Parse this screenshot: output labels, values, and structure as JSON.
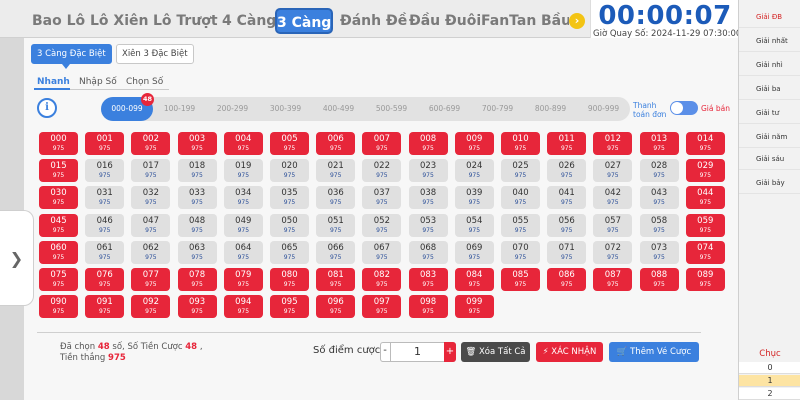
{
  "game_tabs": [
    {
      "label": "Bao Lô"
    },
    {
      "label": "Lô Xiên"
    },
    {
      "label": "Lô Trượt"
    },
    {
      "label": "4 Càng"
    },
    {
      "label": "3 Càng",
      "active": true
    },
    {
      "label": "Đánh Đề"
    },
    {
      "label": "Đầu Đuôi"
    },
    {
      "label": "FanTan"
    },
    {
      "label": "Bầu"
    }
  ],
  "timer": {
    "countdown": "00:00:07",
    "draw_time": "Giờ Quay Số: 2024-11-29 07:30:00"
  },
  "prizes": [
    "Giải ĐB",
    "Giải nhất",
    "Giải nhì",
    "Giải ba",
    "Giải tư",
    "Giải năm",
    "Giải sáu",
    "Giải bảy"
  ],
  "chuc": {
    "title": "Chục",
    "rows": [
      "0",
      "1",
      "2"
    ]
  },
  "sub_tabs": [
    "3 Càng Đặc Biệt",
    "Xiên 3 Đặc Biệt"
  ],
  "modes": [
    "Nhanh",
    "Nhập Số",
    "Chọn Số"
  ],
  "info_icon": "i",
  "ranges": [
    "000-099",
    "100-199",
    "200-299",
    "300-399",
    "400-499",
    "500-599",
    "600-699",
    "700-799",
    "800-899",
    "900-999"
  ],
  "range_badge": "48",
  "quick_label": "Thanh toán đơn",
  "toggle_label": "Giá bán",
  "odds": "975",
  "numbers": [
    "000",
    "001",
    "002",
    "003",
    "004",
    "005",
    "006",
    "007",
    "008",
    "009",
    "010",
    "011",
    "012",
    "013",
    "014",
    "015",
    "016",
    "017",
    "018",
    "019",
    "020",
    "021",
    "022",
    "023",
    "024",
    "025",
    "026",
    "027",
    "028",
    "029",
    "030",
    "031",
    "032",
    "033",
    "034",
    "035",
    "036",
    "037",
    "038",
    "039",
    "040",
    "041",
    "042",
    "043",
    "044",
    "045",
    "046",
    "047",
    "048",
    "049",
    "050",
    "051",
    "052",
    "053",
    "054",
    "055",
    "056",
    "057",
    "058",
    "059",
    "060",
    "061",
    "062",
    "063",
    "064",
    "065",
    "066",
    "067",
    "068",
    "069",
    "070",
    "071",
    "072",
    "073",
    "074",
    "075",
    "076",
    "077",
    "078",
    "079",
    "080",
    "081",
    "082",
    "083",
    "084",
    "085",
    "086",
    "087",
    "088",
    "089",
    "090",
    "091",
    "092",
    "093",
    "094",
    "095",
    "096",
    "097",
    "098",
    "099"
  ],
  "selected": [
    "000",
    "001",
    "002",
    "003",
    "004",
    "005",
    "006",
    "007",
    "008",
    "009",
    "010",
    "011",
    "012",
    "013",
    "014",
    "015",
    "029",
    "030",
    "044",
    "045",
    "059",
    "060",
    "074",
    "075",
    "076",
    "077",
    "078",
    "079",
    "080",
    "081",
    "082",
    "083",
    "084",
    "085",
    "086",
    "087",
    "088",
    "089",
    "090",
    "091",
    "092",
    "093",
    "094",
    "095",
    "096",
    "097",
    "098",
    "099"
  ],
  "summary": {
    "chosen_label": "Đã chọn",
    "chosen_count": "48",
    "chosen_unit": "số,",
    "bet_label": "Số Tiền Cược",
    "bet_amount": "48",
    "bet_sep": ",",
    "win_label": "Tiền thắng",
    "win_amount": "975"
  },
  "bet": {
    "label": "Số điểm cược",
    "minus": "-",
    "value": "1",
    "plus": "+"
  },
  "buttons": {
    "clear": "Xóa Tất Cả",
    "confirm": "XÁC NHẬN",
    "add": "Thêm Vé Cược"
  },
  "icons": {
    "scroll": "chevron-right-icon",
    "handle": "chevron-right-icon",
    "clear": "trash-icon",
    "confirm": "bolt-icon",
    "add": "cart-icon"
  }
}
